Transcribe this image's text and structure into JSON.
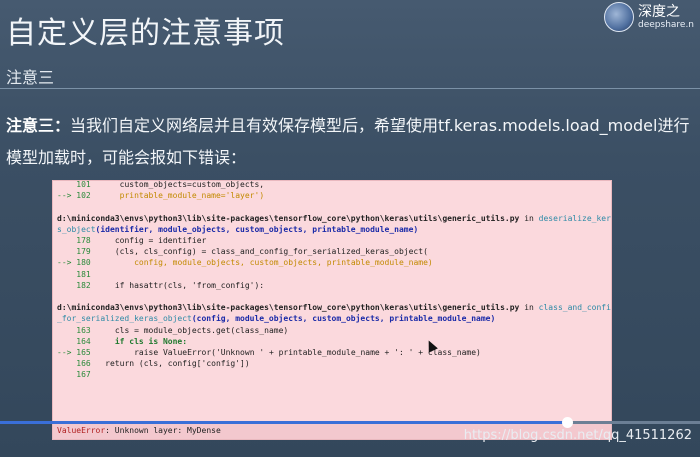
{
  "header": {
    "title": "自定义层的注意事项",
    "subtitle": "注意三"
  },
  "logo": {
    "name": "深度之",
    "url": "deepshare.n"
  },
  "paragraph": {
    "lead": "注意三：",
    "text": "当我们自定义网络层并且有效保存模型后，希望使用tf.keras.models.load_model进行模型加载时，可能会报如下错误："
  },
  "code": {
    "l101_num": "101",
    "l101_text": "custom_objects=custom_objects,",
    "l102_arrow": "-->",
    "l102_num": "102",
    "l102_text": "printable_module_name='layer')",
    "path1": "d:\\miniconda3\\envs\\python3\\lib\\site-packages\\tensorflow_core\\python\\keras\\utils\\generic_utils.py",
    "in1": "in",
    "func1a": "deserialize_kera",
    "func1b": "s_object",
    "args1": "(identifier, module_objects, custom_objects, printable_module_name)",
    "l178_num": "178",
    "l178_text": "config = identifier",
    "l179_num": "179",
    "l179_text": "(cls, cls_config) = class_and_config_for_serialized_keras_object(",
    "l180_arrow": "-->",
    "l180_num": "180",
    "l180_text": "config, module_objects, custom_objects, printable_module_name)",
    "l181_num": "181",
    "l182_num": "182",
    "l182_text": "if hasattr(cls, 'from_config'):",
    "path2": "d:\\miniconda3\\envs\\python3\\lib\\site-packages\\tensorflow_core\\python\\keras\\utils\\generic_utils.py",
    "in2": "in",
    "func2a": "class_and_config",
    "func2b": "_for_serialized_keras_object",
    "args2": "(config, module_objects, custom_objects, printable_module_name)",
    "l163_num": "163",
    "l163_text": "cls = module_objects.get(class_name)",
    "l164_num": "164",
    "l164_text": "if cls is None:",
    "l165_arrow": "-->",
    "l165_num": "165",
    "l165_text": "raise ValueError('Unknown ' + printable_module_name + ': ' + class_name)",
    "l166_num": "166",
    "l166_text": "return (cls, config['config'])",
    "l167_num": "167",
    "error_type": "ValueError",
    "error_msg": ": Unknown layer: MyDense"
  },
  "player": {
    "progress_fraction": 0.81,
    "accent": "#3a6fd8"
  },
  "watermark": "https://blog.csdn.net/qq_41511262"
}
